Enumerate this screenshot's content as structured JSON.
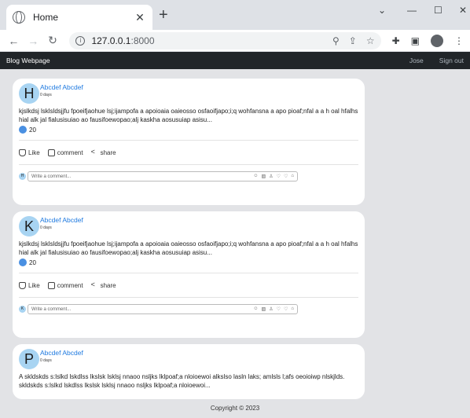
{
  "browser": {
    "tab_title": "Home",
    "url_host": "127.0.0.1",
    "url_port": ":8000"
  },
  "nav": {
    "brand": "Blog Webpage",
    "user": "Jose",
    "signout": "Sign out"
  },
  "posts": [
    {
      "initial": "H",
      "author": "Abcdef Abcdef",
      "time": "0 days",
      "text": "kjslkdsj lsklsldsjjfu fpoeifjaohue lsj;ijampofa a apoioaia oaieosso osfaoifjapo;i;q wohfansna a apo pioaf;nfal a a h oal hfalhs hial alk jal fialusisuiao ao fausifoewopao;alj kaskha aosusuiap asisu...",
      "likes": "20",
      "like_label": "Like",
      "comment_label": "comment",
      "share_label": "share",
      "mini_initial": "H",
      "comment_placeholder": "Write a comment..."
    },
    {
      "initial": "K",
      "author": "Abcdef Abcdef",
      "time": "0 days",
      "text": "kjslkdsj lsklsldsjjfu fpoeifjaohue lsj;ijampofa a apoioaia oaieosso osfaoifjapo;i;q wohfansna a apo pioaf;nfal a a h oal hfalhs hial alk jal fialusisuiao ao fausifoewopao;alj kaskha aosusuiap asisu...",
      "likes": "20",
      "like_label": "Like",
      "comment_label": "comment",
      "share_label": "share",
      "mini_initial": "K",
      "comment_placeholder": "Write a comment..."
    },
    {
      "initial": "P",
      "author": "Abcdef Abcdef",
      "time": "0 days",
      "text": "A skldskds s:lslkd lskdlss lkslsk lsklsj nnaoo nsljks lklpoaf;a nloioewoi alkslso lasln laks; amlsls l;afs oeoioiwp nlskjlds. skldskds s:lslkd lskdlss lkslsk lsklsj nnaoo nsljks lklpoaf;a nloioewoi..."
    }
  ],
  "footer": "Copyright © 2023"
}
